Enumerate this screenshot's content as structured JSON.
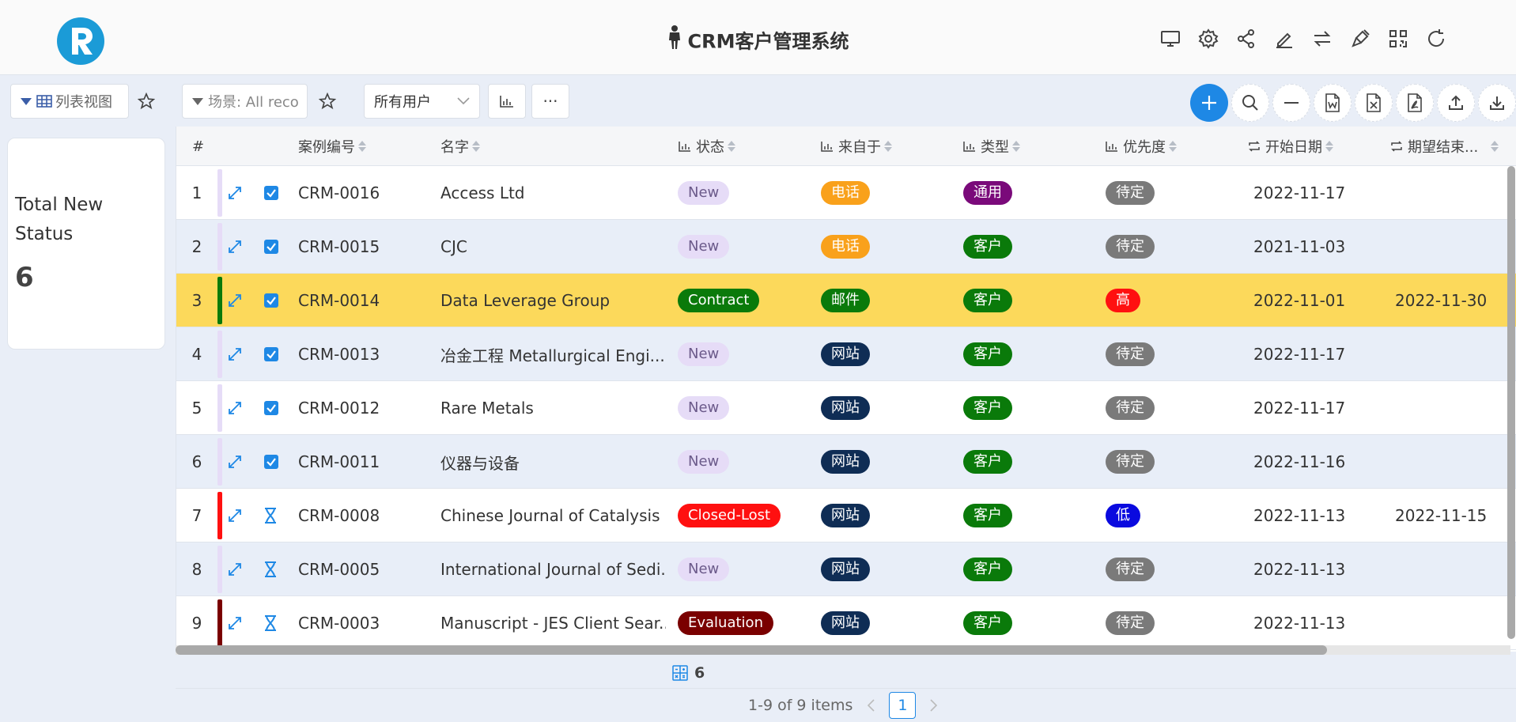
{
  "header": {
    "title": "CRM客户管理系统",
    "icons": [
      "monitor-icon",
      "gear-icon",
      "share-icon",
      "edit-icon",
      "swap-icon",
      "plugin-icon",
      "qrcode-icon",
      "refresh-icon"
    ]
  },
  "toolbar": {
    "view_label": "列表视图",
    "scene_label": "场景: All reco",
    "user_filter": "所有用户",
    "more_label": "···"
  },
  "side_card": {
    "title": "Total New Status",
    "value": "6"
  },
  "table": {
    "columns": [
      "#",
      "案例编号",
      "名字",
      "状态",
      "来自于",
      "类型",
      "优先度",
      "开始日期",
      "期望结束..."
    ],
    "rows": [
      {
        "num": "1",
        "id": "CRM-0016",
        "name": "Access Ltd",
        "status": "New",
        "source": "电话",
        "type": "通用",
        "priority": "待定",
        "start": "2022-11-17",
        "end": "",
        "row_icon": "checkbox-icon"
      },
      {
        "num": "2",
        "id": "CRM-0015",
        "name": "CJC",
        "status": "New",
        "source": "电话",
        "type": "客户",
        "priority": "待定",
        "start": "2021-11-03",
        "end": "",
        "row_icon": "checkbox-icon"
      },
      {
        "num": "3",
        "id": "CRM-0014",
        "name": "Data Leverage Group",
        "status": "Contract",
        "source": "邮件",
        "type": "客户",
        "priority": "高",
        "start": "2022-11-01",
        "end": "2022-11-30",
        "row_icon": "checkbox-icon"
      },
      {
        "num": "4",
        "id": "CRM-0013",
        "name": "冶金工程 Metallurgical Engi...",
        "status": "New",
        "source": "网站",
        "type": "客户",
        "priority": "待定",
        "start": "2022-11-17",
        "end": "",
        "row_icon": "checkbox-icon"
      },
      {
        "num": "5",
        "id": "CRM-0012",
        "name": "Rare Metals",
        "status": "New",
        "source": "网站",
        "type": "客户",
        "priority": "待定",
        "start": "2022-11-17",
        "end": "",
        "row_icon": "checkbox-icon"
      },
      {
        "num": "6",
        "id": "CRM-0011",
        "name": "仪器与设备",
        "status": "New",
        "source": "网站",
        "type": "客户",
        "priority": "待定",
        "start": "2022-11-16",
        "end": "",
        "row_icon": "checkbox-icon"
      },
      {
        "num": "7",
        "id": "CRM-0008",
        "name": "Chinese Journal of Catalysis",
        "status": "Closed-Lost",
        "source": "网站",
        "type": "客户",
        "priority": "低",
        "start": "2022-11-13",
        "end": "2022-11-15",
        "row_icon": "hourglass-icon"
      },
      {
        "num": "8",
        "id": "CRM-0005",
        "name": "International Journal of Sedi...",
        "status": "New",
        "source": "网站",
        "type": "客户",
        "priority": "待定",
        "start": "2022-11-13",
        "end": "",
        "row_icon": "hourglass-icon"
      },
      {
        "num": "9",
        "id": "CRM-0003",
        "name": "Manuscript - JES Client Sear...",
        "status": "Evaluation",
        "source": "网站",
        "type": "客户",
        "priority": "待定",
        "start": "2022-11-13",
        "end": "",
        "row_icon": "hourglass-icon"
      }
    ]
  },
  "colors": {
    "status": {
      "New": "#e6dcf7",
      "Contract": "#0a7a0a",
      "Closed-Lost": "#ff1010",
      "Evaluation": "#7a0000"
    },
    "source": {
      "电话": "#f9a11b",
      "邮件": "#0a7a0a",
      "网站": "#0f2d55"
    },
    "type": {
      "通用": "#7a0a7a",
      "客户": "#0a7a0a"
    },
    "priority": {
      "待定": "#7a7a7a",
      "高": "#ff1010",
      "低": "#0a0adf"
    },
    "rowbar": {
      "New": "#e6dcf7",
      "Contract": "#0a7a0a",
      "Closed-Lost": "#ff1010",
      "Evaluation": "#7a0000"
    },
    "accent": "#1e88e5"
  },
  "footer": {
    "count": "6",
    "range": "1-9 of 9 items",
    "page": "1"
  }
}
